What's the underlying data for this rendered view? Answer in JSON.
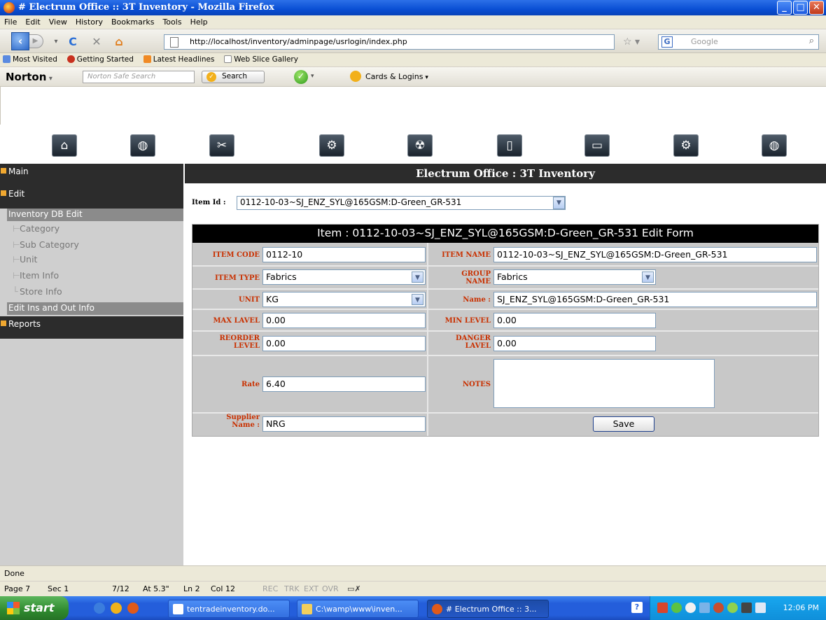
{
  "window": {
    "title": "# Electrum Office :: 3T Inventory - Mozilla Firefox"
  },
  "menu": [
    "File",
    "Edit",
    "View",
    "History",
    "Bookmarks",
    "Tools",
    "Help"
  ],
  "nav": {
    "url": "http://localhost/inventory/adminpage/usrlogin/index.php",
    "search_placeholder": "Google"
  },
  "bookmarks": [
    "Most Visited",
    "Getting Started",
    "Latest Headlines",
    "Web Slice Gallery"
  ],
  "norton": {
    "logo": "Norton",
    "search_placeholder": "Norton Safe Search",
    "search_button": "Search",
    "cards_label": "Cards & Logins"
  },
  "sidebar": {
    "main": "Main",
    "edit": "Edit",
    "inventory_db_edit": "Inventory DB Edit",
    "items": [
      "Category",
      "Sub Category",
      "Unit",
      "Item Info",
      "Store Info"
    ],
    "edit_ins_out": "Edit Ins and Out Info",
    "reports": "Reports"
  },
  "main": {
    "header": "Electrum Office : 3T Inventory",
    "item_id_label": "Item Id :",
    "item_id_value": "0112-10-03~SJ_ENZ_SYL@165GSM:D-Green_GR-531"
  },
  "form": {
    "title": "Item : 0112-10-03~SJ_ENZ_SYL@165GSM:D-Green_GR-531 Edit Form",
    "item_code_label": "ITEM CODE",
    "item_code": "0112-10",
    "item_name_label": "ITEM NAME",
    "item_name": "0112-10-03~SJ_ENZ_SYL@165GSM:D-Green_GR-531",
    "item_type_label": "ITEM TYPE",
    "item_type": "Fabrics",
    "group_name_label_1": "GROUP",
    "group_name_label_2": "NAME",
    "group_name": "Fabrics",
    "unit_label": "UNIT",
    "unit": "KG",
    "name_label": "Name :",
    "name": "SJ_ENZ_SYL@165GSM:D-Green_GR-531",
    "max_label": "MAX LAVEL",
    "max": "0.00",
    "min_label": "MIN LEVEL",
    "min": "0.00",
    "reorder_label_1": "REORDER",
    "reorder_label_2": "LEVEL",
    "reorder": "0.00",
    "danger_label_1": "DANGER",
    "danger_label_2": "LAVEL",
    "danger": "0.00",
    "rate_label": "Rate",
    "rate": "6.40",
    "notes_label": "NOTES",
    "notes": "",
    "supplier_label_1": "Supplier",
    "supplier_label_2": "Name :",
    "supplier": "NRG",
    "save": "Save"
  },
  "status": {
    "text": "Done"
  },
  "word_status": {
    "page": "Page 7",
    "sec": "Sec 1",
    "pages": "7/12",
    "at": "At 5.3\"",
    "ln": "Ln 2",
    "col": "Col 12",
    "rec": "REC",
    "trk": "TRK",
    "ext": "EXT",
    "ovr": "OVR"
  },
  "taskbar": {
    "start": "start",
    "tasks": [
      "tentradeinventory.do...",
      "C:\\wamp\\www\\inven...",
      "# Electrum Office :: 3..."
    ],
    "clock": "12:06 PM"
  }
}
